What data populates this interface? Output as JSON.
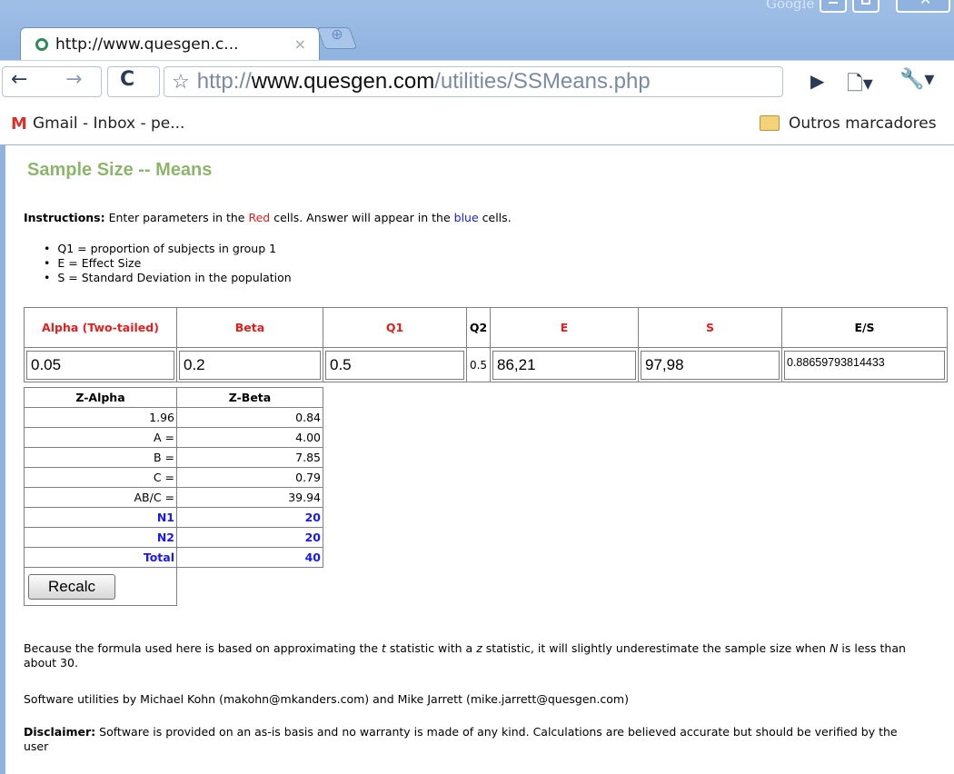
{
  "window": {
    "brand": "Google",
    "close_glyph": "✕"
  },
  "tab": {
    "title": "http://www.quesgen.c...",
    "close_glyph": "×",
    "new_tab_glyph": "⊕"
  },
  "toolbar": {
    "url_scheme": "http://",
    "url_domain": "www.quesgen.com",
    "url_path": "/utilities/SSMeans.php"
  },
  "bookmarks": {
    "gmail_icon": "M",
    "gmail": "Gmail - Inbox - pe...",
    "other": "Outros marcadores"
  },
  "page": {
    "title": "Sample Size -- Means",
    "instructions": {
      "label": "Instructions:",
      "pre": " Enter parameters in the ",
      "red_word": "Red",
      "mid": " cells. Answer will appear in the ",
      "blue_word": "blue",
      "post": " cells."
    },
    "definitions": [
      "Q1 = proportion of subjects in group 1",
      "E = Effect Size",
      "S = Standard Deviation in the population"
    ],
    "params": {
      "headers": {
        "alpha": "Alpha (Two-tailed)",
        "beta": "Beta",
        "q1": "Q1",
        "q2": "Q2",
        "e": "E",
        "s": "S",
        "es": "E/S"
      },
      "values": {
        "alpha": "0.05",
        "beta": "0.2",
        "q1": "0.5",
        "q2": "0.5",
        "e": "86,21",
        "s": "97,98",
        "es": "0.88659793814433"
      }
    },
    "calc": {
      "header_zalpha": "Z-Alpha",
      "header_zbeta": "Z-Beta",
      "zalpha": "1.96",
      "zbeta": "0.84",
      "rows": [
        {
          "label": "A =",
          "value": "4.00"
        },
        {
          "label": "B =",
          "value": "7.85"
        },
        {
          "label": "C =",
          "value": "0.79"
        },
        {
          "label": "AB/C =",
          "value": "39.94"
        }
      ],
      "results": [
        {
          "label": "N1",
          "value": "20"
        },
        {
          "label": "N2",
          "value": "20"
        },
        {
          "label": "Total",
          "value": "40"
        }
      ],
      "recalc_label": "Recalc"
    },
    "note": {
      "p1": "Because the formula used here is based on approximating the ",
      "t": "t",
      "p2": " statistic with a ",
      "z": "z",
      "p3": " statistic, it will slightly underestimate the sample size when ",
      "n": "N",
      "p4": " is less than about 30."
    },
    "credits": "Software utilities by Michael Kohn (makohn@mkanders.com) and Mike Jarrett (mike.jarrett@quesgen.com)",
    "disclaimer": {
      "label": "Disclaimer:",
      "text": " Software is provided on an as-is basis and no warranty is made of any kind. Calculations are believed accurate but should be verified by the user"
    }
  },
  "colors": {
    "title_green": "#8db56c",
    "red": "#e02020",
    "blue": "#1a1aee",
    "frame_blue": "#8fb2df"
  }
}
